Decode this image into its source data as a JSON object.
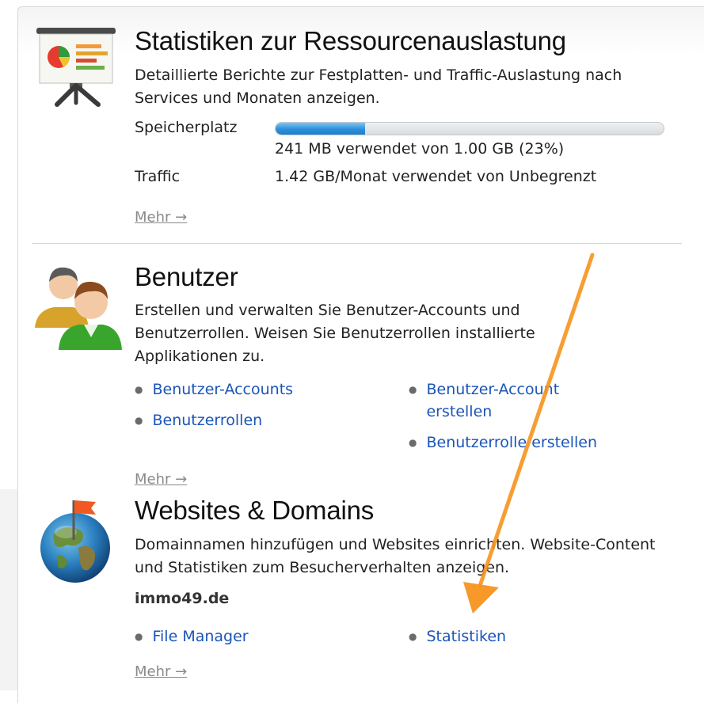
{
  "resources": {
    "title": "Statistiken zur Ressourcenauslastung",
    "description": "Detaillierte Berichte zur Festplatten- und Traffic-Auslastung nach Services und Monaten anzeigen.",
    "disk_label": "Speicherplatz",
    "disk_usage_fraction": 0.23,
    "disk_usage_text": "241 MB verwendet von 1.00 GB (23%)",
    "traffic_label": "Traffic",
    "traffic_value": "1.42 GB/Monat verwendet von Unbegrenzt",
    "more_label": "Mehr →",
    "icon": "presentation-chart-icon"
  },
  "users": {
    "title": "Benutzer",
    "description": "Erstellen und verwalten Sie Benutzer-Accounts und Benutzerrollen. Weisen Sie Benutzerrollen installierte Applikationen zu.",
    "links": [
      "Benutzer-Accounts",
      "Benutzerrollen",
      "Benutzer-Account erstellen",
      "Benutzerrolle erstellen"
    ],
    "more_label": "Mehr →",
    "icon": "users-icon"
  },
  "websites": {
    "title": "Websites & Domains",
    "description": "Domainnamen hinzufügen und Websites einrichten. Website-Content und Statistiken zum Besucherverhalten anzeigen.",
    "domain": "immo49.de",
    "links": [
      "File Manager",
      "Statistiken"
    ],
    "more_label": "Mehr →",
    "icon": "globe-flag-icon"
  },
  "annotation": {
    "color": "#f7941d",
    "icon": "arrow-annotation"
  }
}
